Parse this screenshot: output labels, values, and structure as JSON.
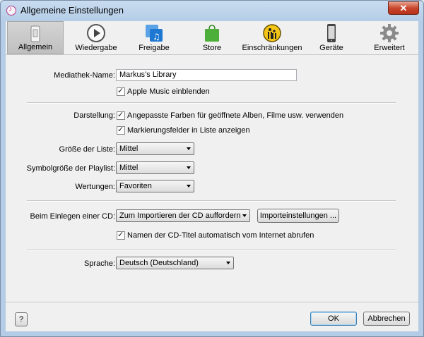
{
  "window": {
    "title": "Allgemeine Einstellungen",
    "close": "✕"
  },
  "toolbar": {
    "tabs": [
      {
        "label": "Allgemein",
        "icon": "general-switch-icon",
        "selected": true
      },
      {
        "label": "Wiedergabe",
        "icon": "play-icon"
      },
      {
        "label": "Freigabe",
        "icon": "music-share-icon"
      },
      {
        "label": "Store",
        "icon": "shopping-bag-icon"
      },
      {
        "label": "Einschränkungen",
        "icon": "parental-restriction-icon"
      },
      {
        "label": "Geräte",
        "icon": "phone-device-icon"
      },
      {
        "label": "Erweitert",
        "icon": "gear-icon"
      }
    ]
  },
  "library": {
    "name_label": "Mediathek-Name:",
    "name_value": "Markus’s Library",
    "apple_music_label": "Apple Music einblenden"
  },
  "display": {
    "label": "Darstellung:",
    "custom_colors_label": "Angepasste Farben für geöffnete Alben, Filme usw. verwenden",
    "checkboxes_label": "Markierungsfelder in Liste anzeigen",
    "list_size_label": "Größe der Liste:",
    "list_size_value": "Mittel",
    "playlist_icon_label": "Symbolgröße der Playlist:",
    "playlist_icon_value": "Mittel",
    "ratings_label": "Wertungen:",
    "ratings_value": "Favoriten"
  },
  "cd": {
    "insert_label": "Beim Einlegen einer CD:",
    "insert_value": "Zum Importieren der CD auffordern",
    "import_settings_button": "Importeinstellungen ...",
    "fetch_names_label": "Namen der CD-Titel automatisch vom Internet abrufen"
  },
  "language": {
    "label": "Sprache:",
    "value": "Deutsch (Deutschland)"
  },
  "footer": {
    "help_button": "?",
    "ok_button": "OK",
    "cancel_button": "Abbrechen"
  },
  "colors": {
    "accent": "#3c7fb1",
    "store_green": "#4caf3a",
    "freigabe_blue": "#1e78d2",
    "restriction_yellow": "#f3c516"
  }
}
